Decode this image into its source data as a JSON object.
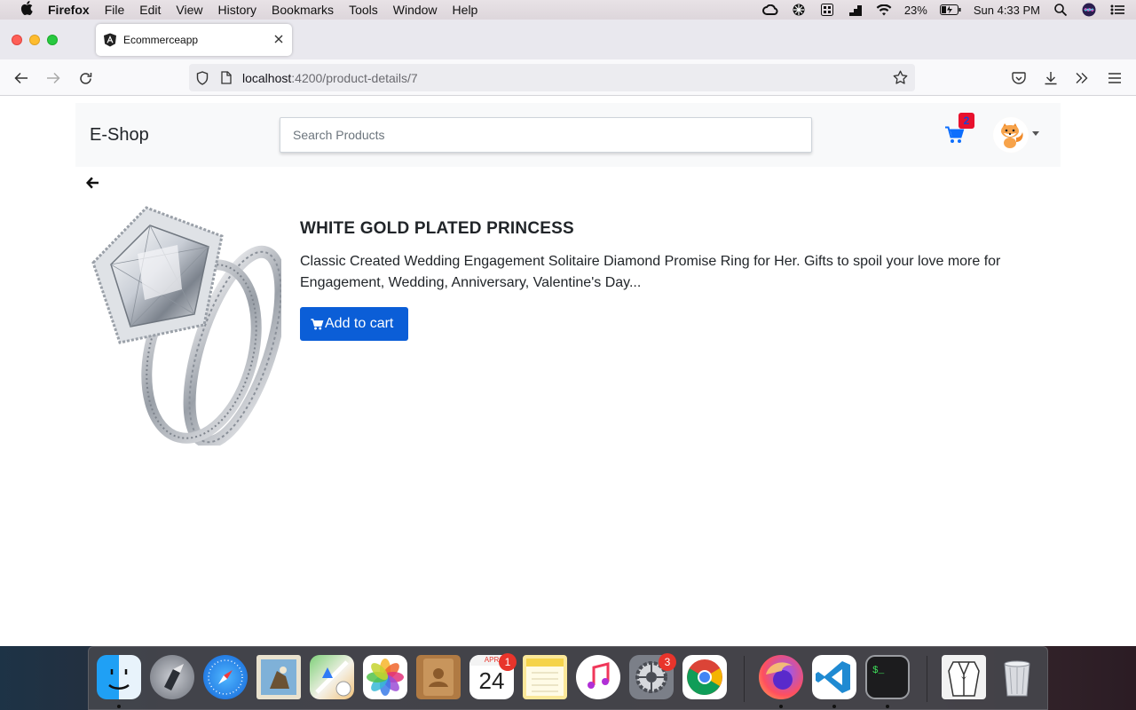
{
  "menubar": {
    "app": "Firefox",
    "items": [
      "File",
      "Edit",
      "View",
      "History",
      "Bookmarks",
      "Tools",
      "Window",
      "Help"
    ],
    "battery": "23%",
    "clock": "Sun 4:33 PM"
  },
  "browser": {
    "tab_title": "Ecommerceapp",
    "url_host": "localhost",
    "url_path": ":4200/product-details/7"
  },
  "shop": {
    "brand": "E-Shop",
    "search_placeholder": "Search Products",
    "cart_count": "2"
  },
  "product": {
    "title": "WHITE GOLD PLATED PRINCESS",
    "description": "Classic Created Wedding Engagement Solitaire Diamond Promise Ring for Her. Gifts to spoil your love more for Engagement, Wedding, Anniversary, Valentine's Day...",
    "add_to_cart": "Add to cart"
  },
  "dock": {
    "calendar_month": "APR",
    "calendar_day": "24",
    "calendar_badge": "1",
    "settings_badge": "3",
    "items": [
      "finder-icon",
      "launchpad-icon",
      "safari-icon",
      "mail-icon",
      "maps-icon",
      "photos-icon",
      "contacts-icon",
      "calendar-icon",
      "notes-icon",
      "music-icon",
      "system-preferences-icon",
      "chrome-icon",
      "firefox-icon",
      "vscode-icon",
      "terminal-icon",
      "archive-icon",
      "trash-icon"
    ]
  },
  "colors": {
    "primary_button": "#0b5ed7",
    "cart_icon": "#0d6efd",
    "badge_bg": "#e8112d"
  }
}
